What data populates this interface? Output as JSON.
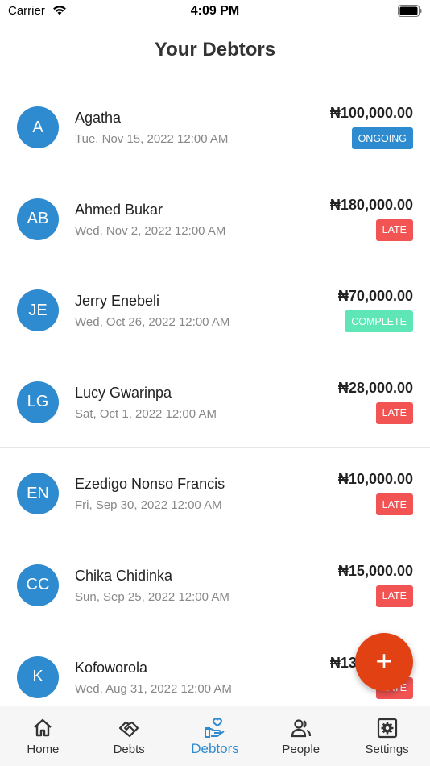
{
  "status_bar": {
    "carrier": "Carrier",
    "time": "4:09 PM"
  },
  "page": {
    "title": "Your Debtors"
  },
  "colors": {
    "accent": "#2f8bcf",
    "ongoing": "#2f8bcf",
    "late": "#f25353",
    "complete": "#5fe6b6",
    "fab": "#e24113"
  },
  "debtors": [
    {
      "initials": "A",
      "name": "Agatha",
      "date": "Tue, Nov 15, 2022 12:00 AM",
      "amount": "₦100,000.00",
      "status": "ONGOING",
      "status_color": "#2f8bcf"
    },
    {
      "initials": "AB",
      "name": "Ahmed Bukar",
      "date": "Wed, Nov 2, 2022 12:00 AM",
      "amount": "₦180,000.00",
      "status": "LATE",
      "status_color": "#f25353"
    },
    {
      "initials": "JE",
      "name": "Jerry Enebeli",
      "date": "Wed, Oct 26, 2022 12:00 AM",
      "amount": "₦70,000.00",
      "status": "COMPLETE",
      "status_color": "#5fe6b6"
    },
    {
      "initials": "LG",
      "name": "Lucy Gwarinpa",
      "date": "Sat, Oct 1, 2022 12:00 AM",
      "amount": "₦28,000.00",
      "status": "LATE",
      "status_color": "#f25353"
    },
    {
      "initials": "EN",
      "name": "Ezedigo Nonso Francis",
      "date": "Fri, Sep 30, 2022 12:00 AM",
      "amount": "₦10,000.00",
      "status": "LATE",
      "status_color": "#f25353"
    },
    {
      "initials": "CC",
      "name": "Chika Chidinka",
      "date": "Sun, Sep 25, 2022 12:00 AM",
      "amount": "₦15,000.00",
      "status": "LATE",
      "status_color": "#f25353"
    },
    {
      "initials": "K",
      "name": "Kofoworola",
      "date": "Wed, Aug 31, 2022 12:00 AM",
      "amount": "₦130,000.00",
      "status": "LATE",
      "status_color": "#f25353"
    }
  ],
  "fab": {
    "label": "+",
    "icon": "plus-icon"
  },
  "tabs": [
    {
      "label": "Home",
      "icon": "home-icon",
      "active": false
    },
    {
      "label": "Debts",
      "icon": "handshake-icon",
      "active": false
    },
    {
      "label": "Debtors",
      "icon": "hand-heart-icon",
      "active": true
    },
    {
      "label": "People",
      "icon": "people-icon",
      "active": false
    },
    {
      "label": "Settings",
      "icon": "gear-icon",
      "active": false
    }
  ]
}
